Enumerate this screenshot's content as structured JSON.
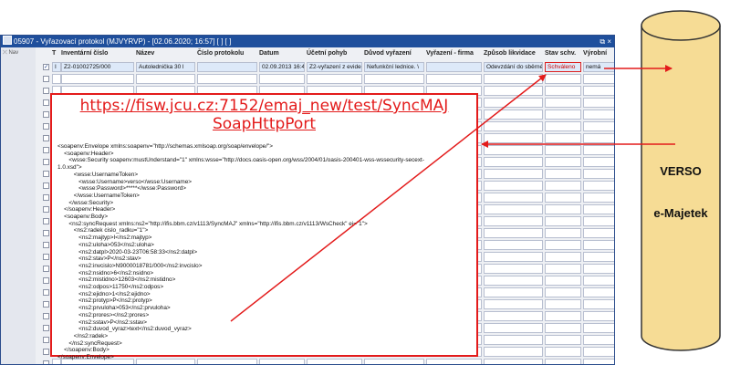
{
  "window": {
    "title": "05907 - Vyřazovací protokol (MJVYRVP) - [02.06.2020; 16:57]  [ ]  [ ]",
    "controls": "⧉ ×"
  },
  "nav": {
    "label": "Nav"
  },
  "table": {
    "columns": [
      "T",
      "Inventární číslo",
      "Název",
      "Číslo protokolu",
      "Datum",
      "Účetní pohyb",
      "Důvod vyřazení",
      "Vyřazení - firma",
      "Způsob likvidace",
      "Stav schv.",
      "Výrobní"
    ],
    "row1": {
      "checked": "✓",
      "type": "I",
      "inventory_number": "Z2-01002725/000",
      "name": "Autolednička 30 l",
      "protocol_number": "",
      "date": "02.09.2013 16:4",
      "accounting_movement": "Z2-vyřazení z eviden",
      "reason": "Nefunkční lednice. \\",
      "disposal_company": "",
      "disposal_method": "Odevzdání do sběrné",
      "approval_status": "Schváleno",
      "production": "nemá"
    }
  },
  "soap": {
    "url_line1": "https://fisw.jcu.cz:7152/emaj_new/test/SyncMAJ",
    "url_line2": "SoapHttpPort",
    "xml": "<soapenv:Envelope xmlns:soapenv=\"http://schemas.xmlsoap.org/soap/envelope/\">\n    <soapenv:Header>\n       <wsse:Security soapenv:mustUnderstand=\"1\" xmlns:wsse=\"http://docs.oasis-open.org/wss/2004/01/oasis-200401-wss-wssecurity-secext-\n1.0.xsd\">\n          <wsse:UsernameToken>\n             <wsse:Username>verso</wsse:Username>\n             <wsse:Password>*****</wsse:Password>\n          </wsse:UsernameToken>\n       </wsse:Security>\n    </soapenv:Header>\n    <soapenv:Body>\n       <ns2:syncRequest xmlns:ns2=\"http://ifis.bbm.cz/v1113/SyncMAJ\" xmlns=\"http://ifis.bbm.cz/v1113/WsCheck\" ej=\"1\">\n          <ns2:radek cislo_radku=\"1\">\n             <ns2:majtyp>I</ns2:majtyp>\n             <ns2:uloha>053</ns2:uloha>\n             <ns2:datpl>2020-03-23T06:58:33</ns2:datpl>\n             <ns2:stav>P</ns2:stav>\n             <ns2:invcislo>N9000018781/000</ns2:invcislo>\n             <ns2:nsidno>6</ns2:nsidno>\n             <ns2:mistidno>12603</ns2:mistidno>\n             <ns2:odpos>11750</ns2:odpos>\n             <ns2:ejidno>1</ns2:ejidno>\n             <ns2:protyp>P</ns2:protyp>\n             <ns2:prvuloha>053</ns2:prvuloha>\n             <ns2:prores></ns2:prores>\n             <ns2:sstav>P</ns2:sstav>\n             <ns2:duvod_vyraz>text</ns2:duvod_vyraz>\n          </ns2:radek>\n       </ns2:syncRequest>\n    </soapenv:Body>\n</soapenv:Envelope>"
  },
  "cylinder": {
    "line1": "VERSO",
    "line2": "e-Majetek",
    "fill_color": "#f6dc95",
    "stroke_color": "#333333"
  },
  "colors": {
    "accent_red": "#e31b1b",
    "titlebar_blue": "#1f4f9c"
  }
}
